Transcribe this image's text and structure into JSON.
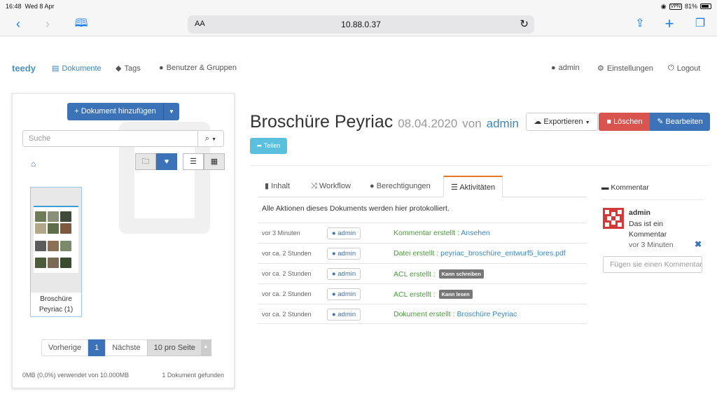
{
  "status": {
    "time": "16:48",
    "date": "Wed 8 Apr",
    "vpn": "VPN",
    "battery": "81%"
  },
  "browser": {
    "text_size": "AA",
    "url": "10.88.0.37"
  },
  "nav": {
    "brand": "teedy",
    "documents": "Dokumente",
    "tags": "Tags",
    "users_groups": "Benutzer & Gruppen",
    "user": "admin",
    "settings": "Einstellungen",
    "logout": "Logout"
  },
  "sidebar": {
    "add_document": "Dokument hinzufügen",
    "search_placeholder": "Suche",
    "document": {
      "title_line1": "Broschüre",
      "title_line2": "Peyriac (1)"
    },
    "pager": {
      "prev": "Vorherige",
      "current": "1",
      "next": "Nächste",
      "per_page": "10 pro Seite"
    },
    "quota": "0MB (0,0%) verwendet von 10.000MB",
    "found": "1 Dokument gefunden"
  },
  "document": {
    "title": "Broschüre Peyriac",
    "date": "08.04.2020",
    "by": "von",
    "author": "admin",
    "share": "Teilen",
    "export": "Exportieren",
    "delete": "Löschen",
    "edit": "Bearbeiten"
  },
  "tabs": {
    "content": "Inhalt",
    "workflow": "Workflow",
    "permissions": "Berechtigungen",
    "activities": "Aktivitäten"
  },
  "activities": {
    "description": "Alle Aktionen dieses Dokuments werden hier protokolliert.",
    "rows": [
      {
        "time": "vor 3 Minuten",
        "user": "admin",
        "action": "Kommentar erstellt :",
        "link": "Ansehen",
        "label": ""
      },
      {
        "time": "vor ca. 2 Stunden",
        "user": "admin",
        "action": "Datei erstellt :",
        "link": "peyriac_broschüre_entwurf5_lores.pdf",
        "label": ""
      },
      {
        "time": "vor ca. 2 Stunden",
        "user": "admin",
        "action": "ACL erstellt :",
        "link": "",
        "label": "Kann schreiben"
      },
      {
        "time": "vor ca. 2 Stunden",
        "user": "admin",
        "action": "ACL erstellt :",
        "link": "",
        "label": "Kann lesen"
      },
      {
        "time": "vor ca. 2 Stunden",
        "user": "admin",
        "action": "Dokument erstellt :",
        "link": "Broschüre Peyriac",
        "label": ""
      }
    ]
  },
  "comments": {
    "heading": "Kommentar",
    "author": "admin",
    "text": "Das ist ein Kommentar",
    "time": "vor 3 Minuten",
    "input_placeholder": "Fügen sie einen Kommentar hinzu"
  }
}
